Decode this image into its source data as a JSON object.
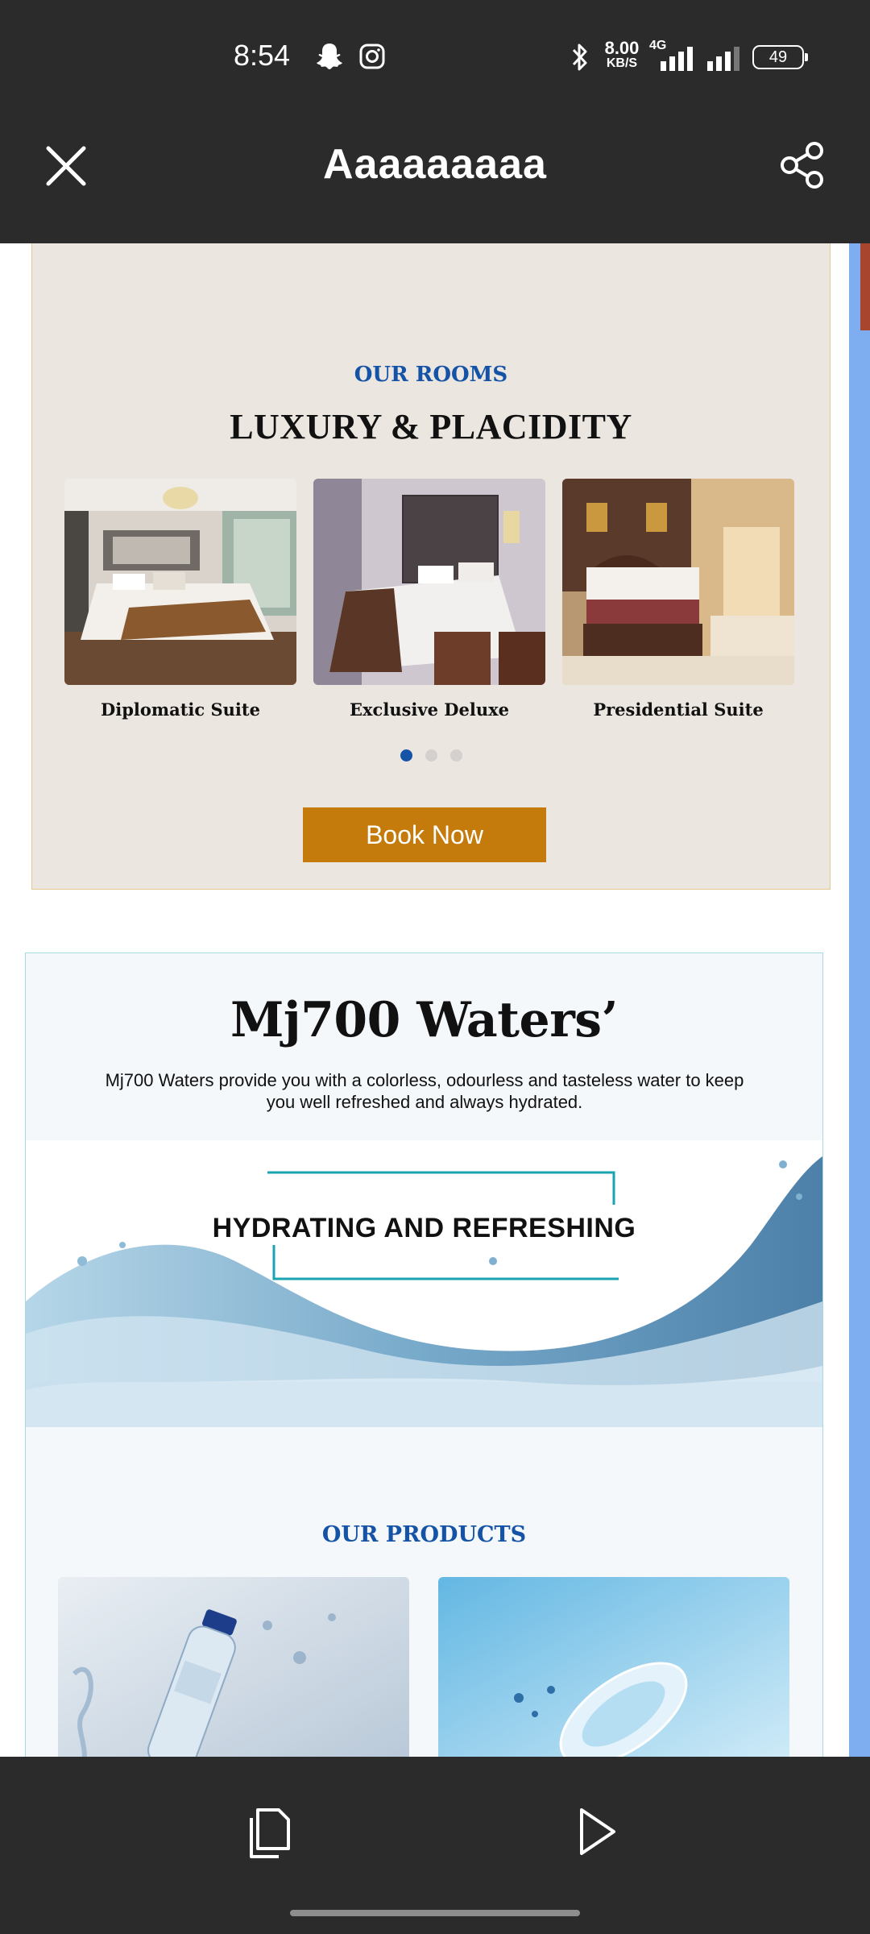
{
  "status_bar": {
    "time": "8:54",
    "speed_value": "8.00",
    "speed_unit": "KB/S",
    "network": "4G",
    "battery": "49",
    "icons": [
      "snapchat-icon",
      "instagram-icon",
      "bluetooth-icon",
      "signal-icon",
      "signal-icon",
      "battery-icon"
    ]
  },
  "header": {
    "title": "Aaaaaaaaa",
    "close_icon": "close-icon",
    "share_icon": "share-icon"
  },
  "rooms_section": {
    "eyebrow": "OUR ROOMS",
    "title": "LUXURY & PLACIDITY",
    "rooms": [
      {
        "name": "Diplomatic Suite"
      },
      {
        "name": "Exclusive Deluxe"
      },
      {
        "name": "Presidential Suite"
      }
    ],
    "carousel": {
      "total": 3,
      "active_index": 0
    },
    "book_button": "Book Now"
  },
  "waters_section": {
    "title": "Mj700 Waters’",
    "description": "Mj700 Waters provide you with a colorless, odourless and tasteless water to keep you well refreshed and always hydrated.",
    "banner_headline": "HYDRATING AND REFRESHING",
    "products_label": "OUR PRODUCTS"
  },
  "bottom_bar": {
    "doc_icon": "document-icon",
    "play_icon": "play-icon"
  },
  "colors": {
    "bar": "#2b2b2b",
    "accent_blue": "#1453a6",
    "book_button": "#c47b0b",
    "rooms_bg": "#ece6e1",
    "teal_frame": "#1aa3b1"
  }
}
